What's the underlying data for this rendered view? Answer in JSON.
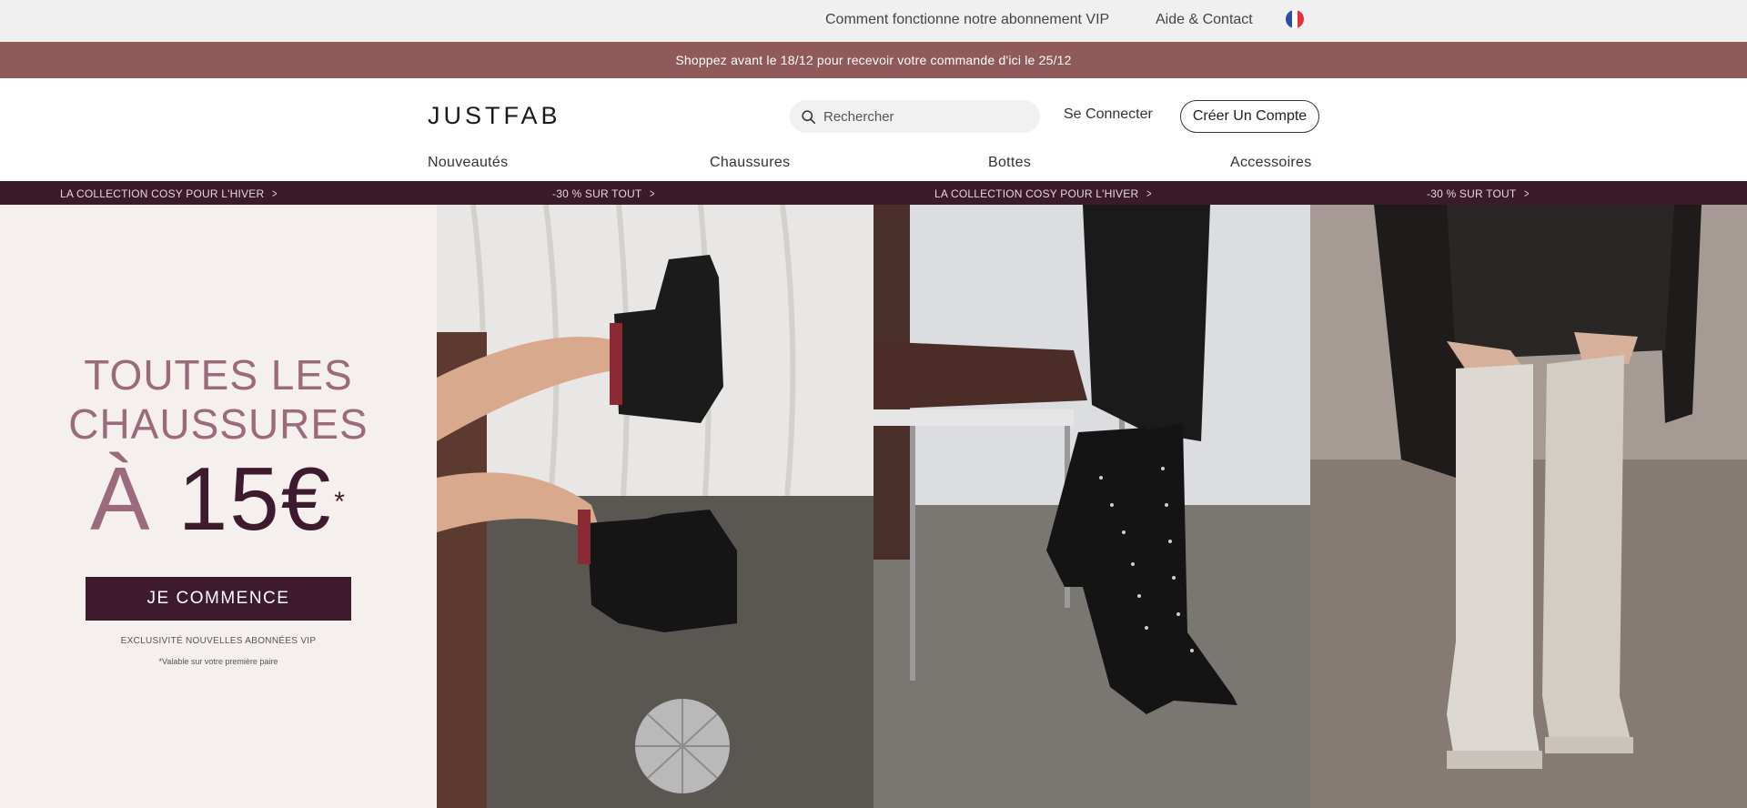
{
  "utility": {
    "vip_link": "Comment fonctionne notre abonnement VIP",
    "help_link": "Aide & Contact"
  },
  "promo_banner": {
    "text": "Shoppez avant le 18/12 pour recevoir votre commande d'ici le 25/12"
  },
  "header": {
    "logo": "JUSTFAB",
    "search_placeholder": "Rechercher",
    "signin": "Se Connecter",
    "create_account": "Créer Un Compte"
  },
  "nav": {
    "items": [
      "Nouveautés",
      "Chaussures",
      "Bottes",
      "Accessoires"
    ]
  },
  "collections": {
    "items": [
      "LA COLLECTION COSY POUR L'HIVER",
      "-30 % SUR TOUT",
      "LA COLLECTION COSY POUR L'HIVER",
      "-30 % SUR TOUT"
    ]
  },
  "hero": {
    "title_line1": "TOUTES LES",
    "title_line2": "CHAUSSURES",
    "price_prefix": "À",
    "price": "15€",
    "price_mark": "*",
    "cta": "JE COMMENCE",
    "exclusive": "EXCLUSIVITÉ NOUVELLES ABONNÉES VIP",
    "note": "*Valable sur votre première paire"
  },
  "colors": {
    "promo_bg": "#8f5a59",
    "strip_bg": "#3b1a2a",
    "brand_plum": "#3d1a2d",
    "brand_mauve": "#9b6a7c",
    "hero_bg": "#f5efee"
  },
  "icons": {
    "search": "search-icon",
    "flag": "france-flag-icon",
    "chevron": "chevron-right-icon"
  }
}
